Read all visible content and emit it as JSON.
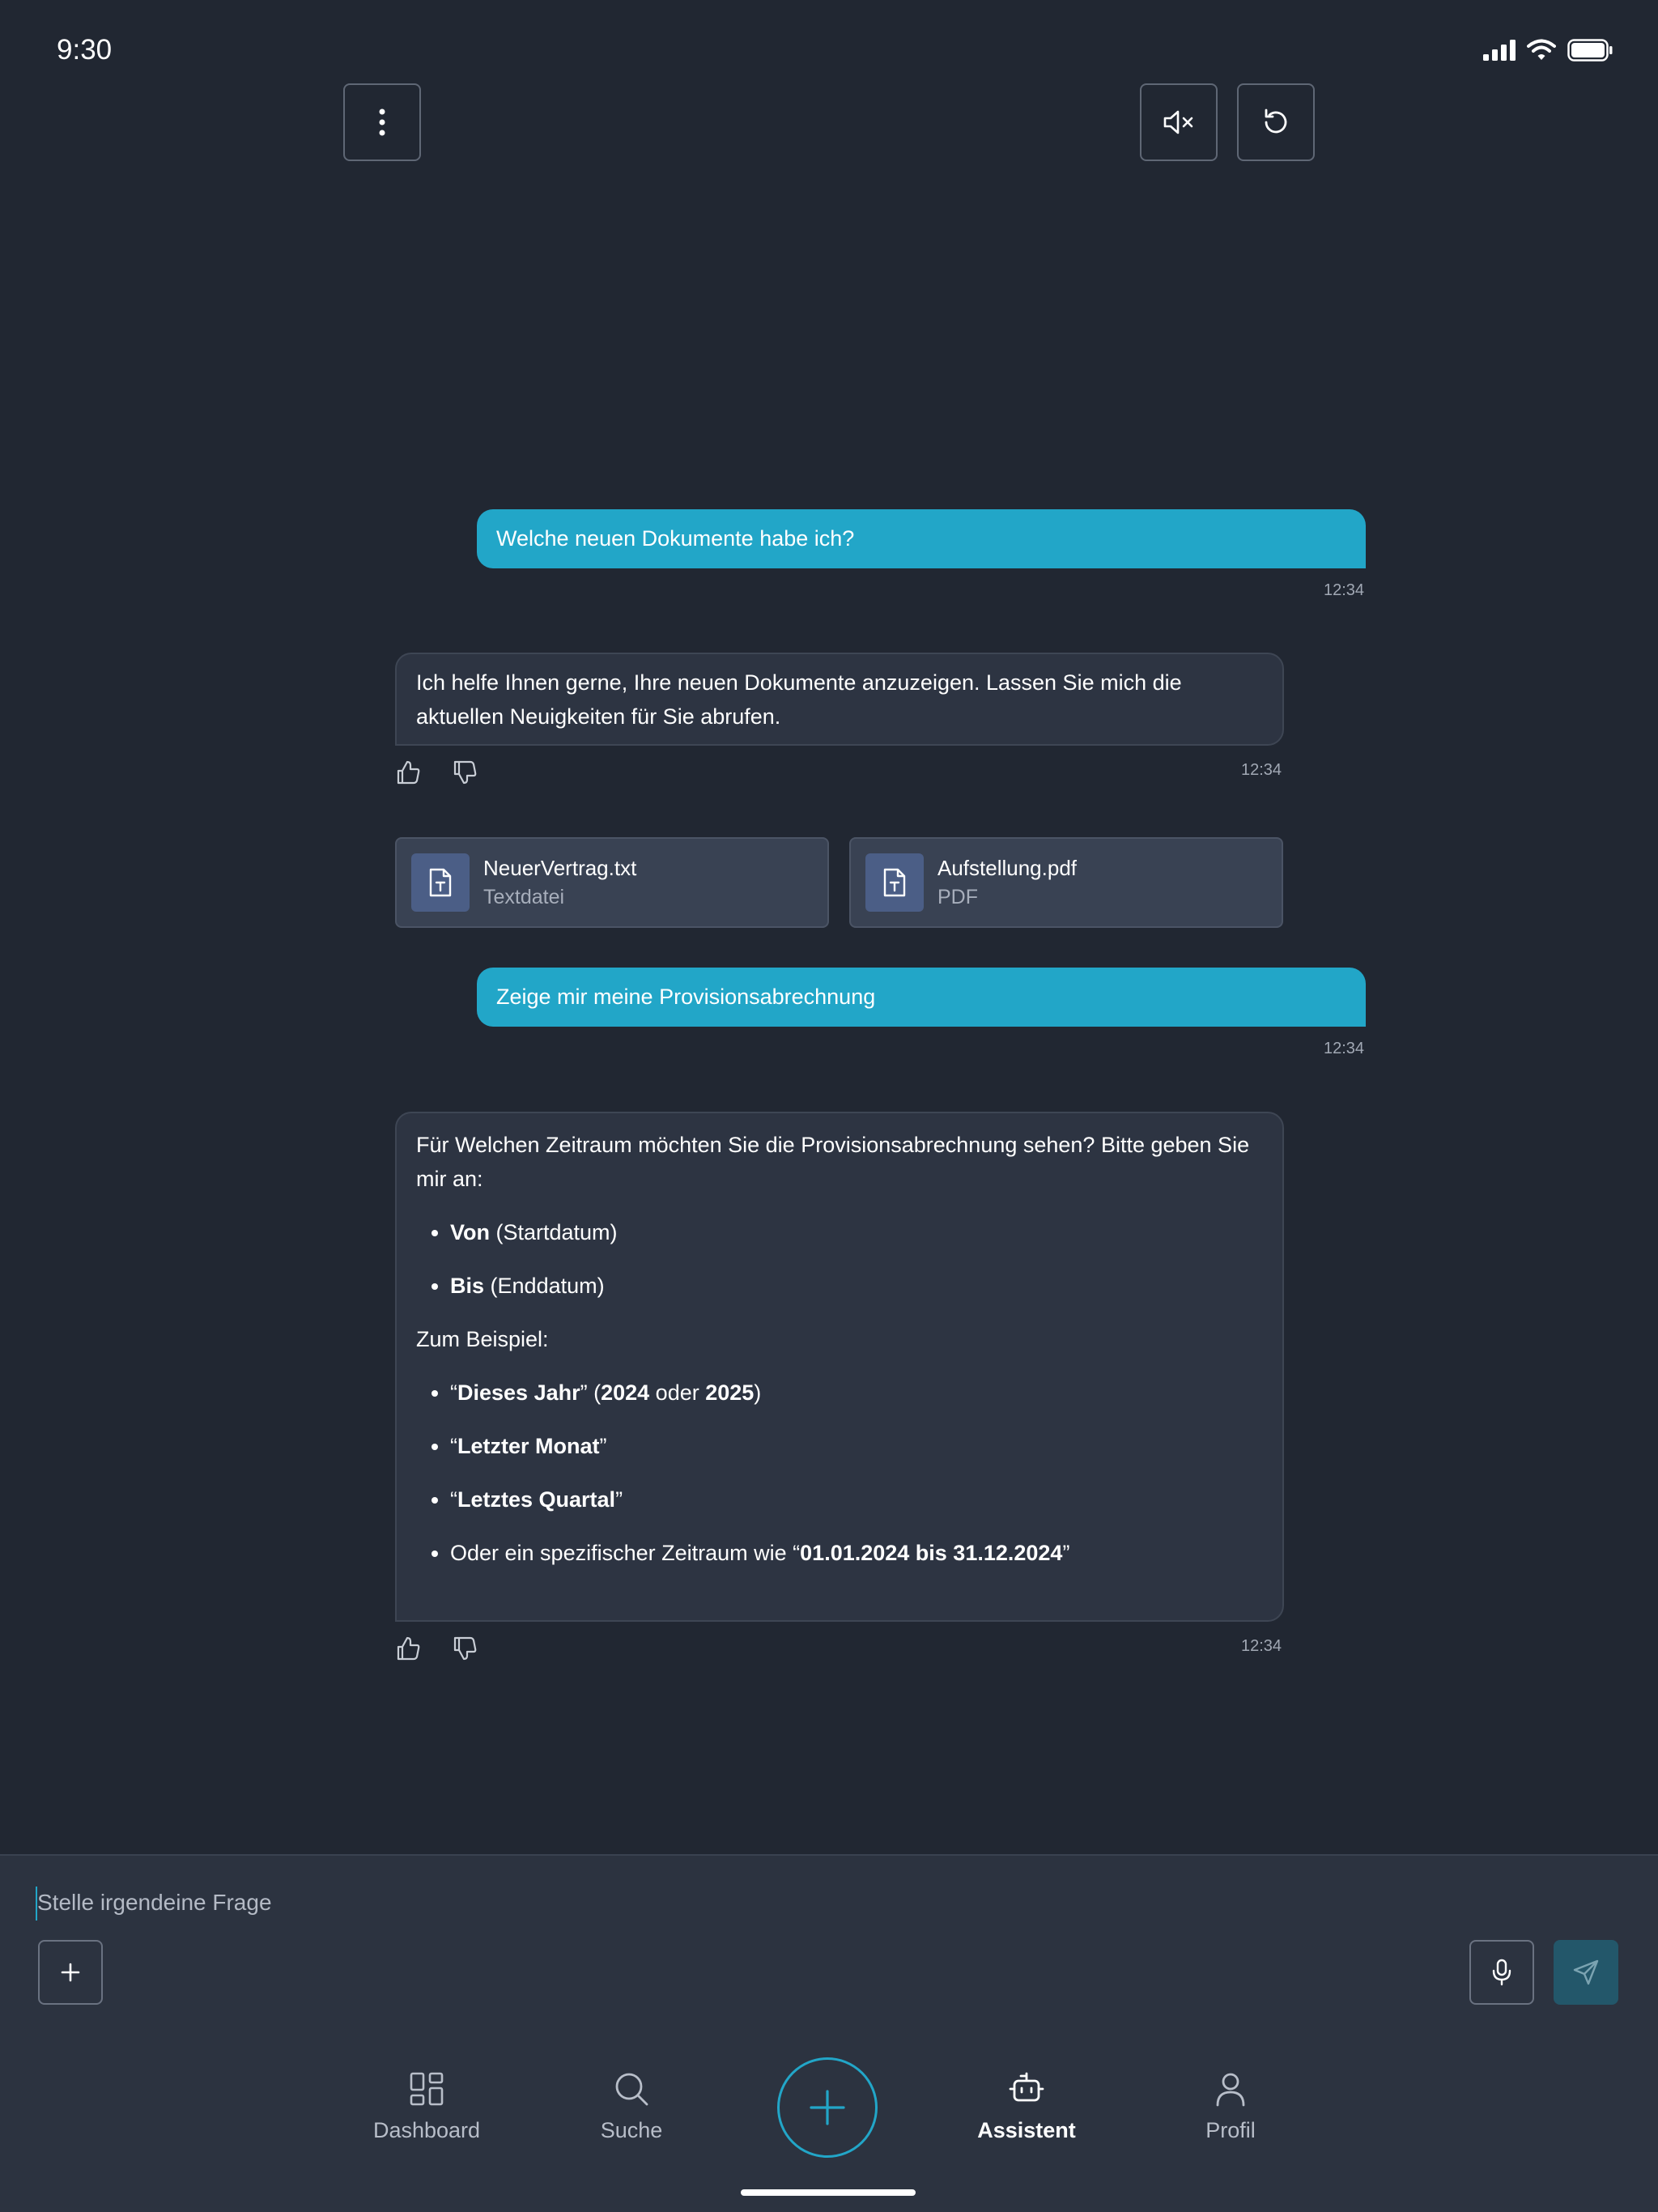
{
  "status_bar": {
    "time": "9:30"
  },
  "chat": {
    "messages": [
      {
        "role": "user",
        "text": "Welche neuen Dokumente habe ich?",
        "time": "12:34"
      },
      {
        "role": "assistant",
        "text": "Ich helfe Ihnen gerne, Ihre neuen Dokumente anzuzeigen. Lassen Sie mich die aktuellen Neuigkeiten für Sie abrufen.",
        "time": "12:34"
      },
      {
        "role": "user",
        "text": "Zeige mir meine Provisionsabrechnung",
        "time": "12:34"
      },
      {
        "role": "assistant",
        "time": "12:34",
        "intro": "Für Welchen Zeitraum möchten Sie die Provisionsabrechnung sehen? Bitte geben Sie mir an:",
        "fields": [
          {
            "bold": "Von",
            "rest": " (Startdatum)"
          },
          {
            "bold": "Bis",
            "rest": " (Enddatum)"
          }
        ],
        "example_heading": "Zum Beispiel:",
        "examples": {
          "e1": {
            "q1": "“",
            "bold": "Dieses Jahr",
            "q2": "” (",
            "b1": "2024",
            "mid": " oder ",
            "b2": "2025",
            "end": ")"
          },
          "e2": {
            "q1": "“",
            "bold": "Letzter Monat",
            "q2": "”"
          },
          "e3": {
            "q1": "“",
            "bold": "Letztes Quartal",
            "q2": "”"
          },
          "e4": {
            "pre": "Oder ein spezifischer Zeitraum wie “",
            "bold": "01.01.2024 bis 31.12.2024",
            "end": "”"
          }
        }
      }
    ],
    "files": [
      {
        "name": "NeuerVertrag.txt",
        "type": "Textdatei"
      },
      {
        "name": "Aufstellung.pdf",
        "type": "PDF"
      }
    ]
  },
  "input": {
    "placeholder": "Stelle irgendeine Frage"
  },
  "nav": {
    "items": [
      {
        "label": "Dashboard",
        "icon": "grid-icon"
      },
      {
        "label": "Suche",
        "icon": "search-icon"
      },
      {
        "label": "Assistent",
        "icon": "robot-icon",
        "active": true
      },
      {
        "label": "Profil",
        "icon": "user-icon"
      }
    ]
  },
  "colors": {
    "background": "#212732",
    "accent": "#22a6c8",
    "assistant_bubble": "#2d3442",
    "file_card": "#394253",
    "panel": "#2c3340"
  }
}
